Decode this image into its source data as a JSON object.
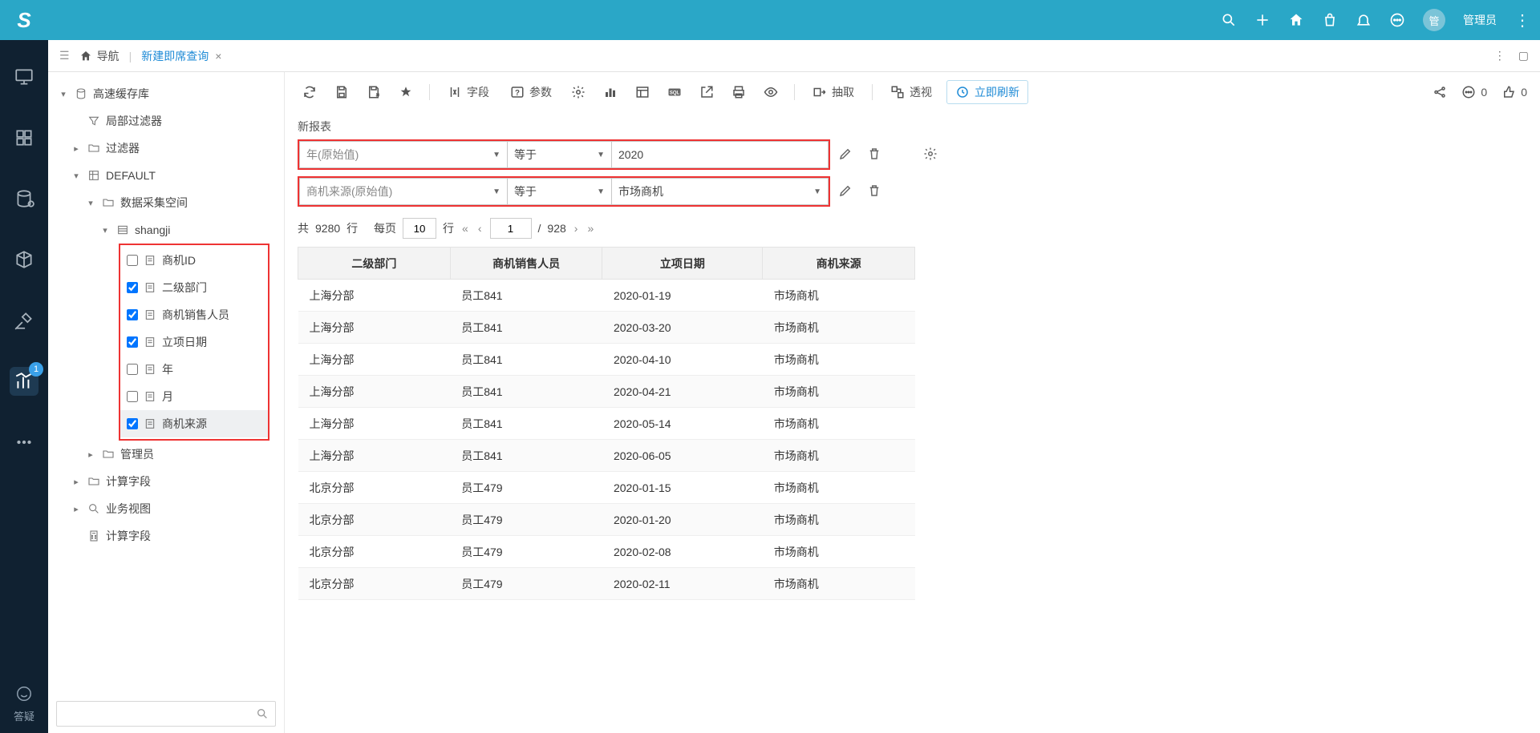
{
  "topbar": {
    "logo": "S",
    "avatar_letter": "管",
    "username": "管理员"
  },
  "leftrail": {
    "badge_count": "1",
    "help_label": "答疑"
  },
  "tabbar": {
    "nav_label": "导航",
    "tab1_label": "新建即席查询"
  },
  "tree": {
    "n0": "高速缓存库",
    "n1": "局部过滤器",
    "n2": "过滤器",
    "n3": "DEFAULT",
    "n4": "数据采集空间",
    "n5": "shangji",
    "fields": {
      "f0": "商机ID",
      "f1": "二级部门",
      "f2": "商机销售人员",
      "f3": "立项日期",
      "f4": "年",
      "f5": "月",
      "f6": "商机来源"
    },
    "n6": "管理员",
    "n7": "计算字段",
    "n8": "业务视图",
    "n9": "计算字段"
  },
  "toolbar": {
    "fields_label": "字段",
    "params_label": "参数",
    "extract_label": "抽取",
    "pivot_label": "透视",
    "refresh_label": "立即刷新",
    "comment_count": "0",
    "like_count": "0"
  },
  "report_title": "新报表",
  "filters": {
    "r0": {
      "field": "年(原始值)",
      "op": "等于",
      "val": "2020"
    },
    "r1": {
      "field": "商机来源(原始值)",
      "op": "等于",
      "val": "市场商机"
    }
  },
  "pager": {
    "total_prefix": "共",
    "total_rows": "9280",
    "total_suffix": "行",
    "perpage_prefix": "每页",
    "perpage_value": "10",
    "perpage_suffix": "行",
    "page_value": "1",
    "page_sep": "/",
    "page_count": "928"
  },
  "table": {
    "headers": {
      "c0": "二级部门",
      "c1": "商机销售人员",
      "c2": "立项日期",
      "c3": "商机来源"
    },
    "rows": [
      {
        "c0": "上海分部",
        "c1": "员工841",
        "c2": "2020-01-19",
        "c3": "市场商机"
      },
      {
        "c0": "上海分部",
        "c1": "员工841",
        "c2": "2020-03-20",
        "c3": "市场商机"
      },
      {
        "c0": "上海分部",
        "c1": "员工841",
        "c2": "2020-04-10",
        "c3": "市场商机"
      },
      {
        "c0": "上海分部",
        "c1": "员工841",
        "c2": "2020-04-21",
        "c3": "市场商机"
      },
      {
        "c0": "上海分部",
        "c1": "员工841",
        "c2": "2020-05-14",
        "c3": "市场商机"
      },
      {
        "c0": "上海分部",
        "c1": "员工841",
        "c2": "2020-06-05",
        "c3": "市场商机"
      },
      {
        "c0": "北京分部",
        "c1": "员工479",
        "c2": "2020-01-15",
        "c3": "市场商机"
      },
      {
        "c0": "北京分部",
        "c1": "员工479",
        "c2": "2020-01-20",
        "c3": "市场商机"
      },
      {
        "c0": "北京分部",
        "c1": "员工479",
        "c2": "2020-02-08",
        "c3": "市场商机"
      },
      {
        "c0": "北京分部",
        "c1": "员工479",
        "c2": "2020-02-11",
        "c3": "市场商机"
      }
    ]
  }
}
